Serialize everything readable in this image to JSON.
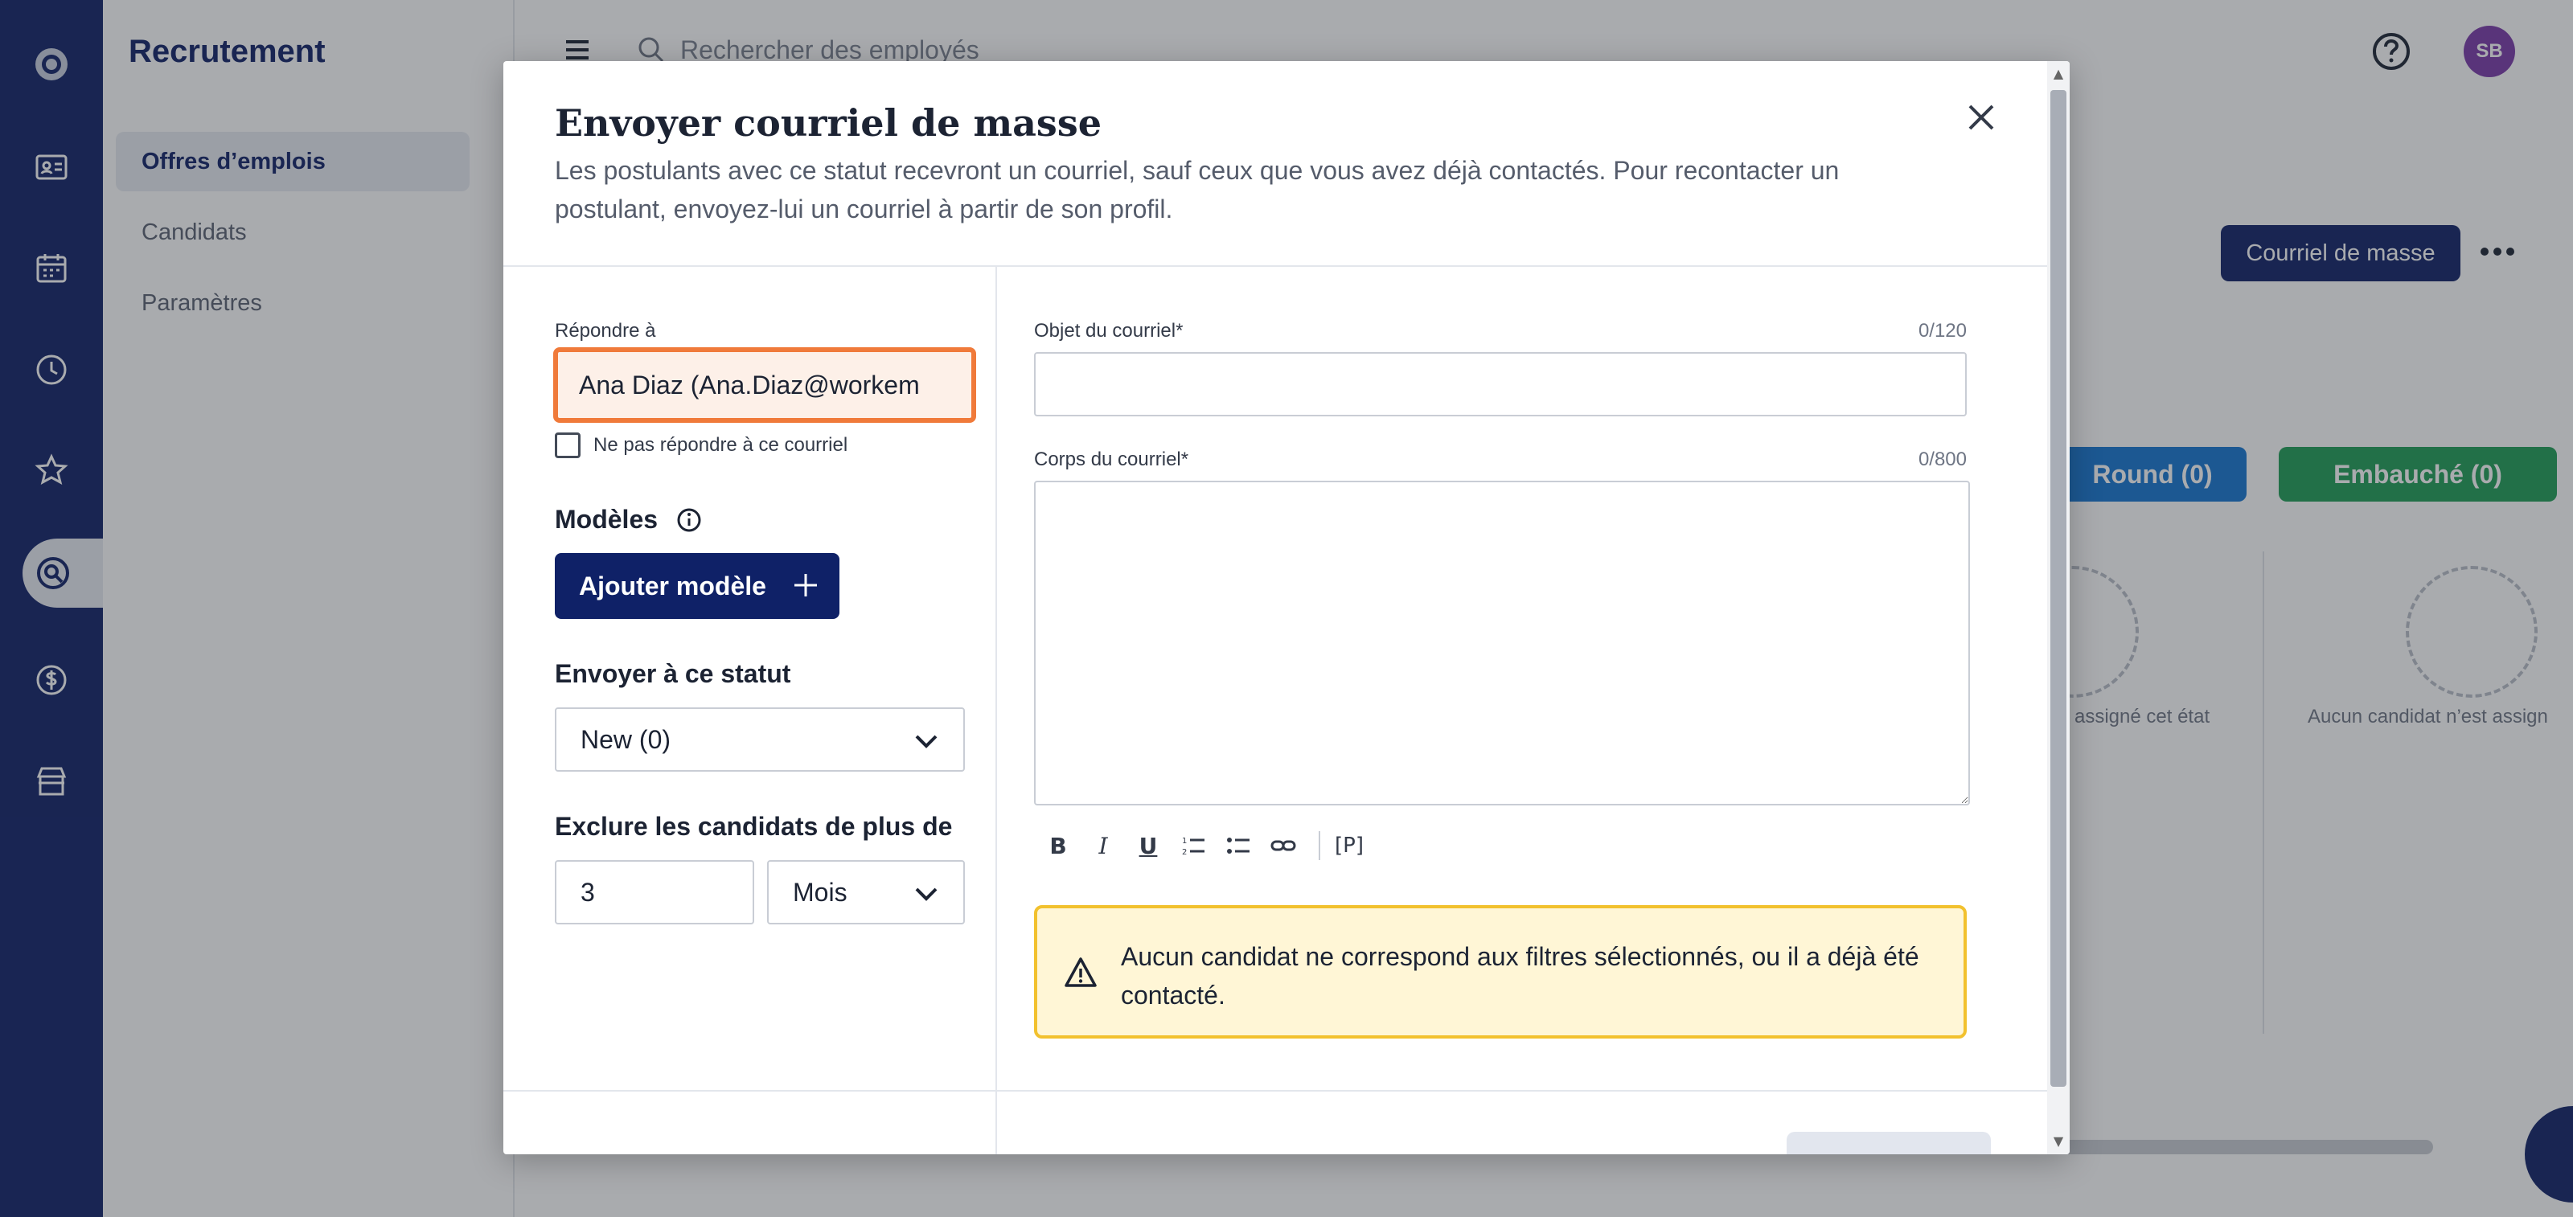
{
  "app": {
    "sidebar_title": "Recrutement",
    "nav": [
      {
        "label": "Offres d’emplois",
        "active": true
      },
      {
        "label": "Candidats",
        "active": false
      },
      {
        "label": "Paramètres",
        "active": false
      }
    ],
    "rail_icons": [
      "logo-icon",
      "id-card-icon",
      "calendar-icon",
      "clock-icon",
      "star-icon",
      "recruit-search-icon",
      "dollar-icon",
      "store-icon"
    ]
  },
  "topbar": {
    "search_placeholder": "Rechercher des employés",
    "avatar_initials": "SB"
  },
  "page": {
    "mass_email_button": "Courriel de masse",
    "stages": [
      {
        "label": "Round (0)",
        "color": "#1576d1"
      },
      {
        "label": "Embauché (0)",
        "color": "#1f9d55"
      }
    ],
    "empty_texts": [
      "assigné cet état",
      "Aucun candidat n’est assign"
    ]
  },
  "modal": {
    "title": "Envoyer courriel de masse",
    "subtitle": "Les postulants avec ce statut recevront un courriel, sauf ceux que vous avez déjà contactés. Pour recontacter un postulant, envoyez-lui un courriel à partir de son profil.",
    "reply_to_label": "Répondre à",
    "reply_to_value": "Ana Diaz (Ana.Diaz@workem",
    "no_reply_label": "Ne pas répondre à ce courriel",
    "templates_label": "Modèles",
    "add_template_button": "Ajouter modèle",
    "send_to_status_label": "Envoyer à ce statut",
    "status_value": "New (0)",
    "exclude_label": "Exclure les candidats de plus de",
    "exclude_number": "3",
    "exclude_unit": "Mois",
    "subject_label": "Objet du courriel*",
    "subject_counter": "0/120",
    "body_label": "Corps du courriel*",
    "body_counter": "0/800",
    "toolbar": {
      "bold": "B",
      "italic": "I",
      "underline": "U",
      "placeholder": "[P]"
    },
    "warning_text": "Aucun candidat ne correspond aux filtres sélectionnés, ou il a déjà été contacté.",
    "colors": {
      "accent": "#0f2167",
      "focus_border": "#f07a3a",
      "warning_bg": "#fff6d6",
      "warning_border": "#f2c12e"
    }
  }
}
